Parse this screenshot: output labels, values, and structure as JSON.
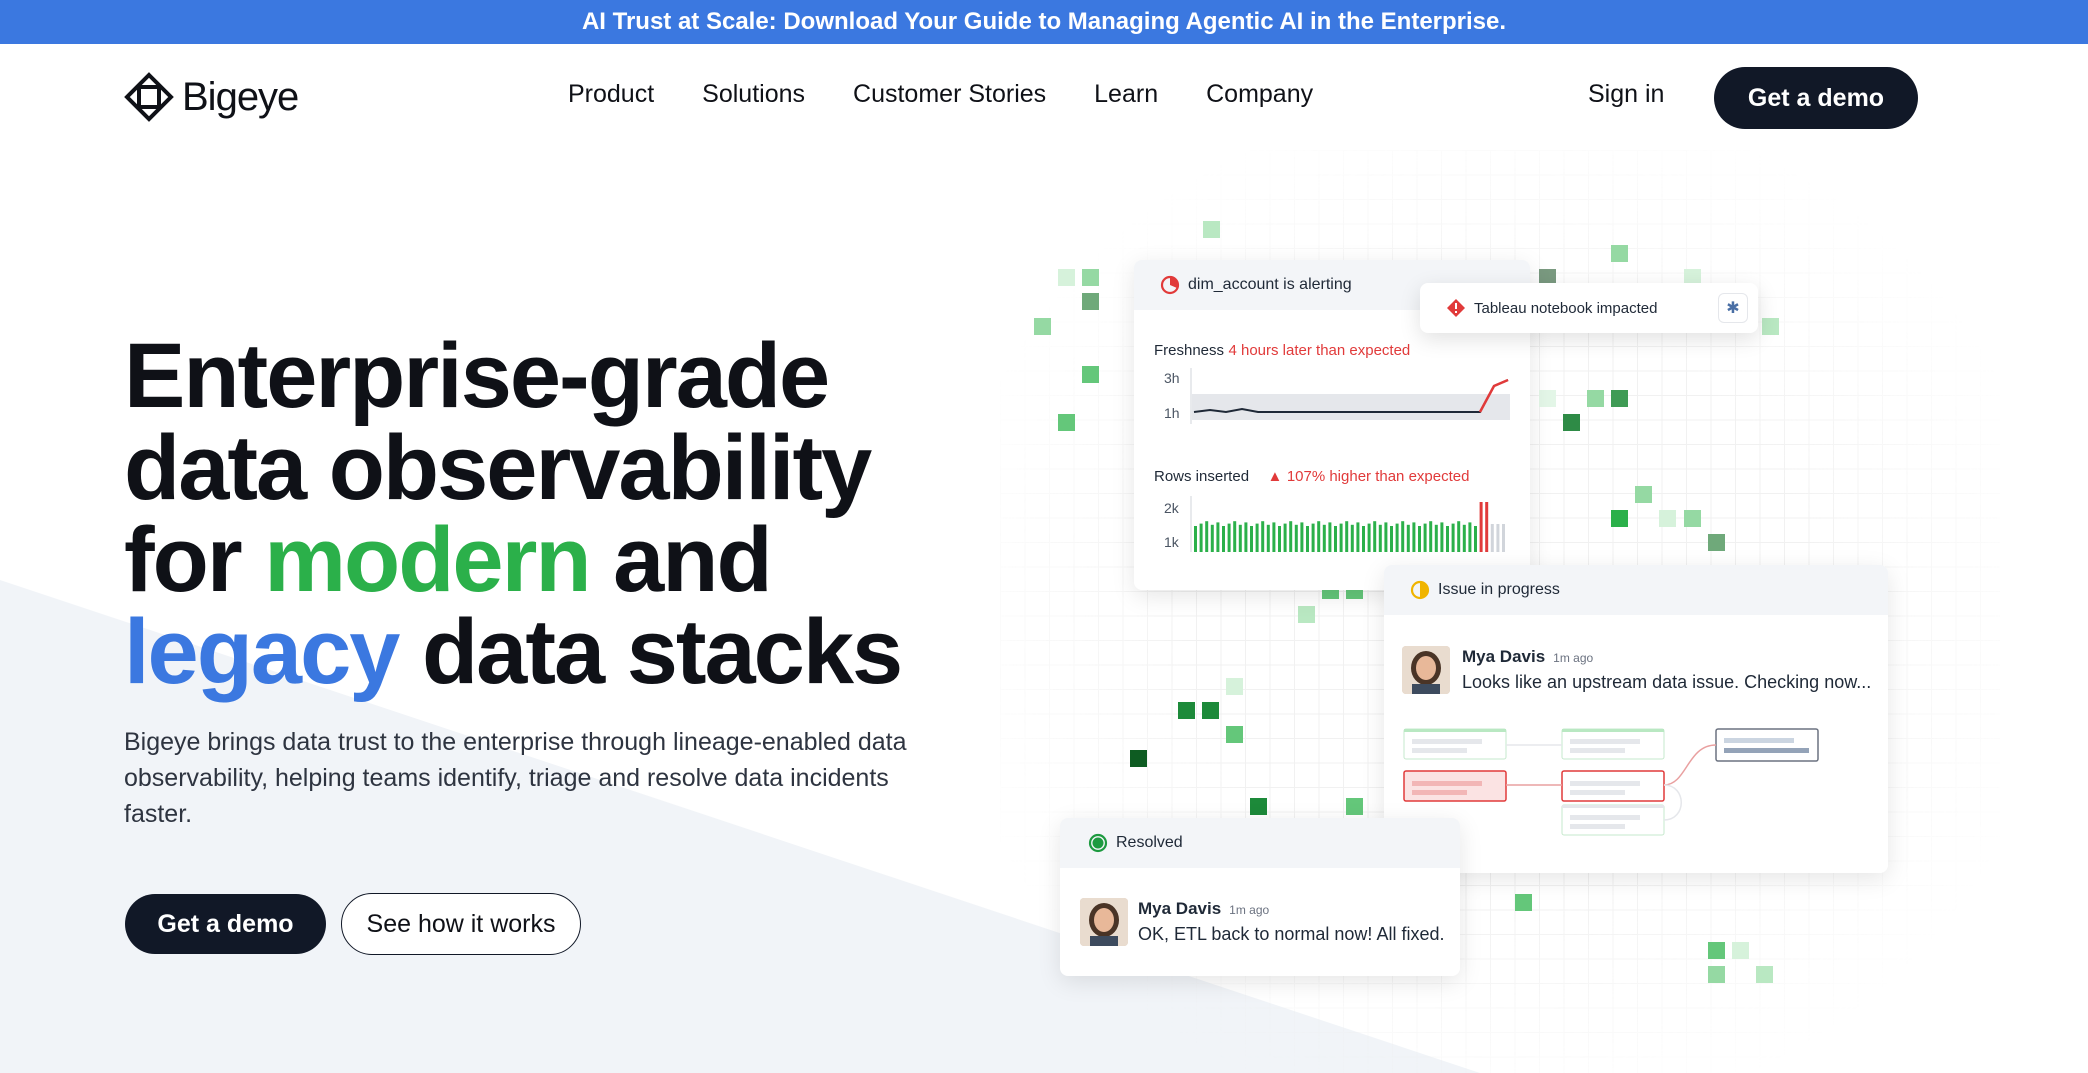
{
  "banner": {
    "text": "AI Trust at Scale: Download Your Guide to Managing Agentic AI in the Enterprise."
  },
  "nav": {
    "logo_text": "Bigeye",
    "items": [
      "Product",
      "Solutions",
      "Customer Stories",
      "Learn",
      "Company"
    ],
    "sign_in": "Sign in",
    "get_demo": "Get a demo"
  },
  "hero": {
    "title_line1": "Enterprise-grade",
    "title_line2": "data observability",
    "title_for": "for",
    "title_modern": "modern",
    "title_and": "and",
    "title_legacy": "legacy",
    "title_stacks": "data stacks",
    "subtitle": "Bigeye brings data trust to the enterprise through lineage-enabled data observability, helping teams identify, triage and resolve data incidents faster.",
    "btn_demo": "Get a demo",
    "btn_how": "See how it works"
  },
  "alert_card": {
    "header": "dim_account is alerting",
    "freshness_label": "Freshness",
    "freshness_note": "4 hours later than expected",
    "freshness_ticks": [
      "3h",
      "1h"
    ],
    "rows_label": "Rows inserted",
    "rows_note": "107% higher than expected",
    "rows_ticks": [
      "2k",
      "1k"
    ]
  },
  "tableau_card": {
    "text": "Tableau notebook impacted"
  },
  "issue_card": {
    "header": "Issue in progress",
    "user": "Mya Davis",
    "time": "1m ago",
    "message": "Looks like an upstream data issue. Checking now..."
  },
  "resolved_card": {
    "header": "Resolved",
    "user": "Mya Davis",
    "time": "1m ago",
    "message": "OK, ETL back to normal now! All fixed."
  },
  "colors": {
    "brand_blue": "#3b78e0",
    "brand_green": "#2bb04a",
    "dark_button": "#111827",
    "alert_red": "#e13a3a"
  }
}
